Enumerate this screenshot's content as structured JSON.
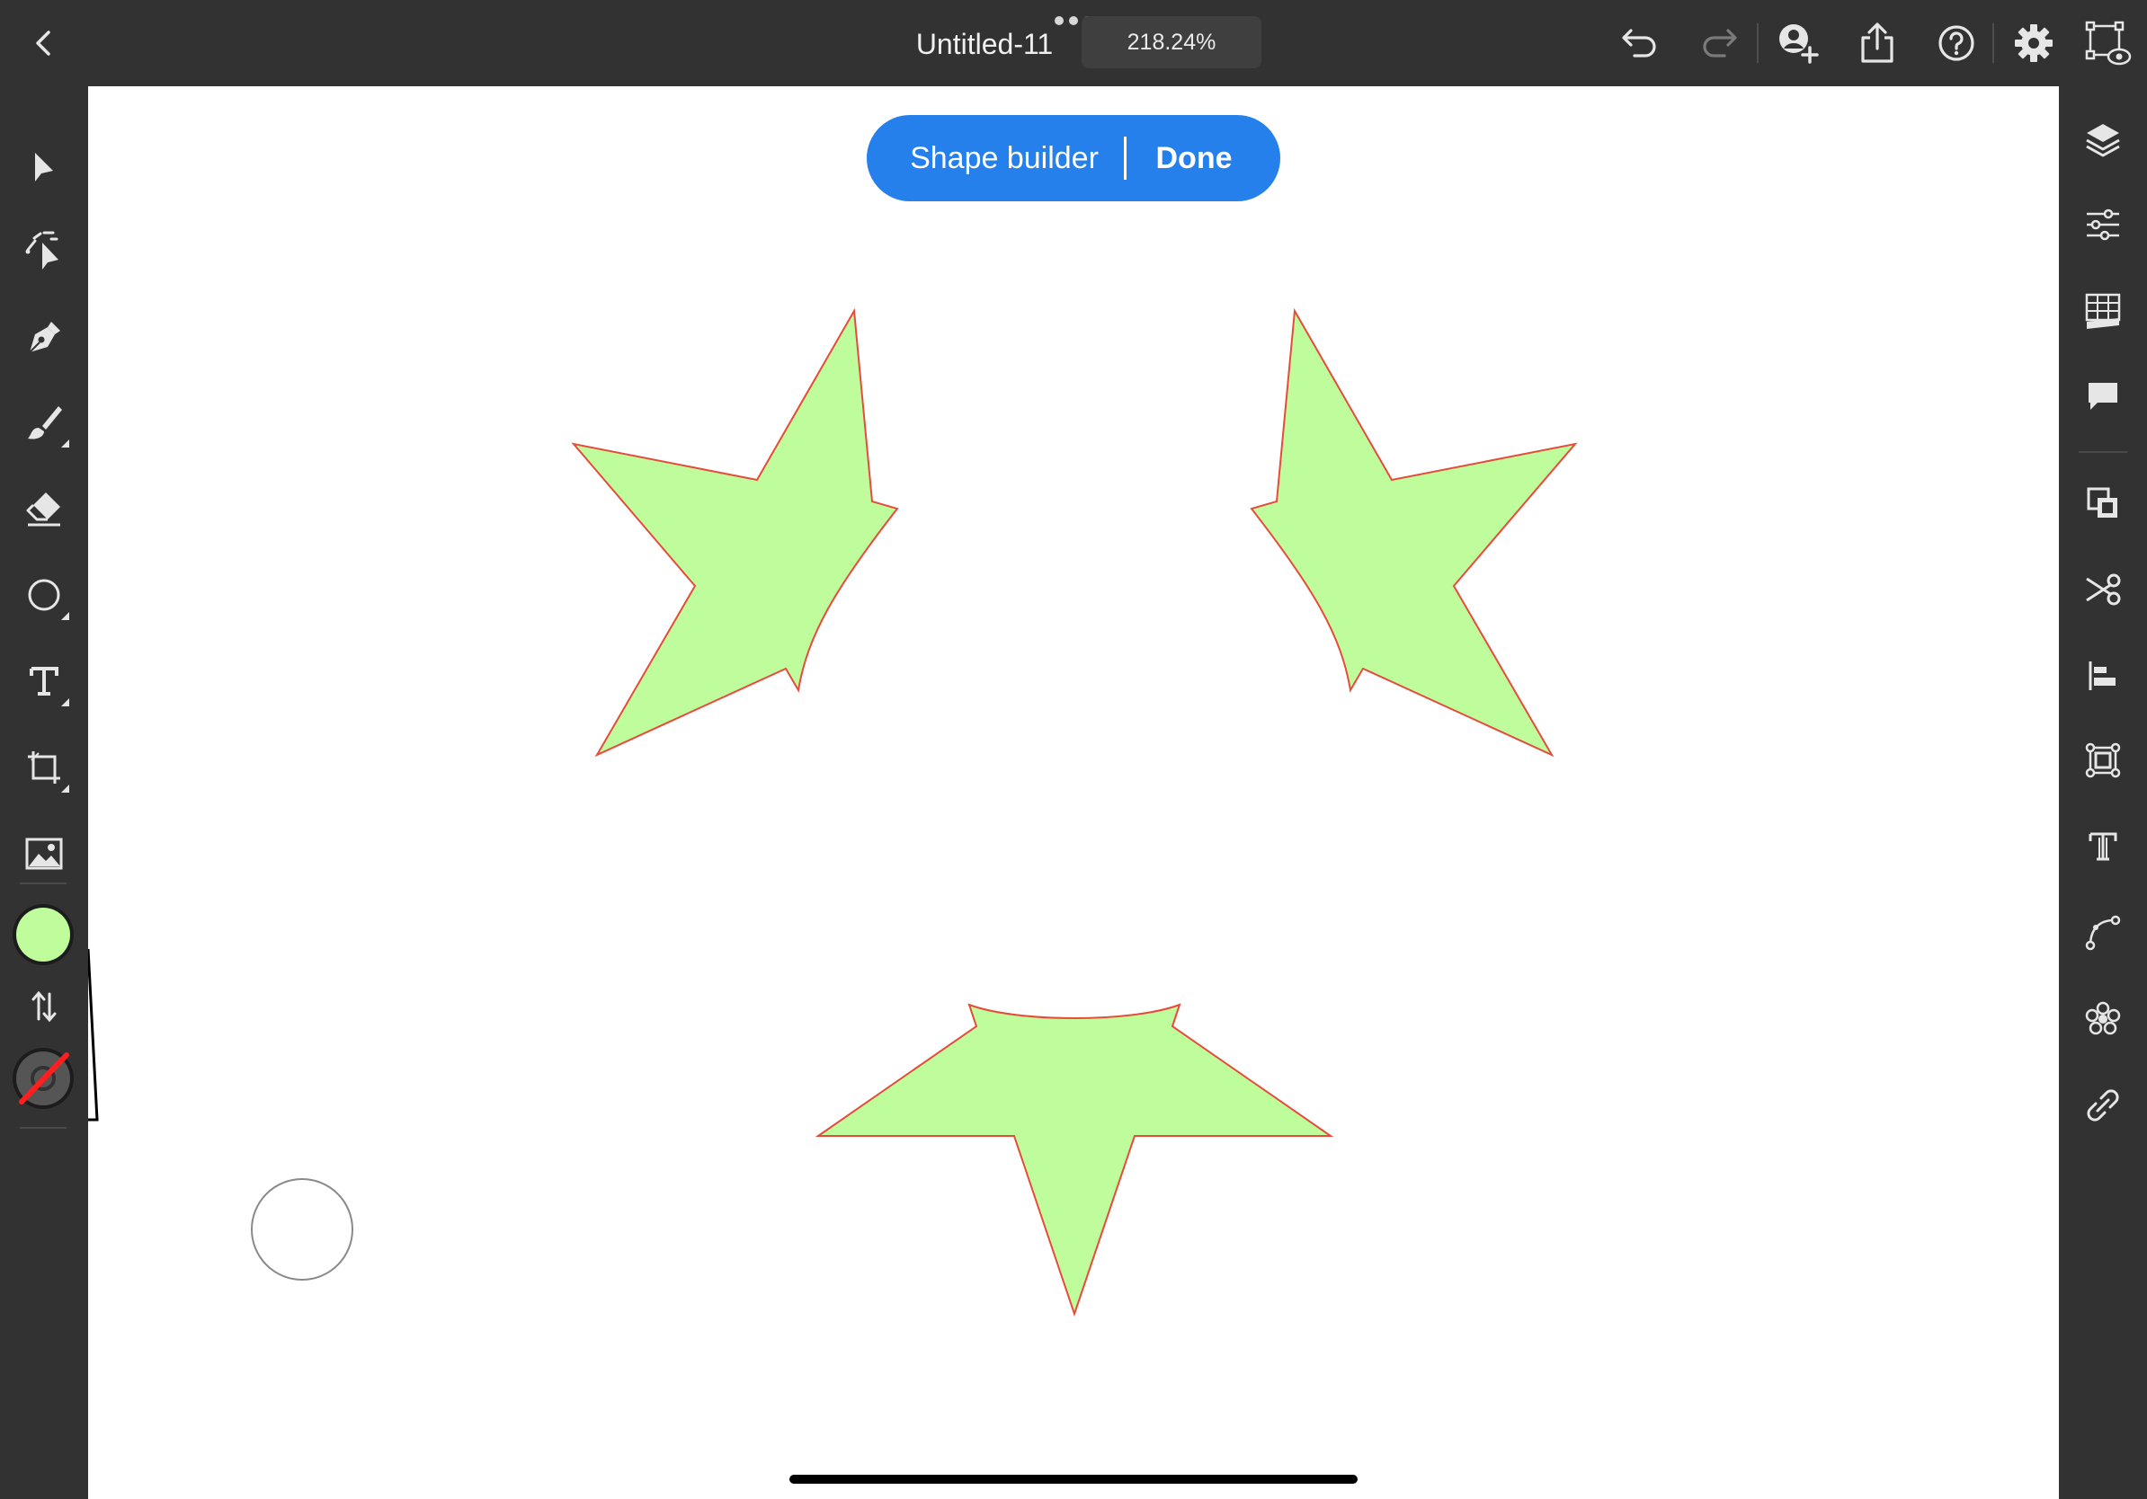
{
  "document": {
    "title": "Untitled-11",
    "zoom": "218.24%"
  },
  "shape_builder": {
    "label": "Shape builder",
    "done_label": "Done"
  },
  "colors": {
    "fill": "#bffc9b",
    "stroke_outline": "#e64b3c",
    "accent": "#2680eb",
    "ui_background": "#323232"
  },
  "top_bar_icons": [
    "back-icon",
    "more-icon",
    "undo-icon",
    "redo-icon",
    "invite-icon",
    "share-icon",
    "help-icon",
    "settings-icon",
    "preview-icon"
  ],
  "left_tools": [
    "selection-icon",
    "direct-selection-icon",
    "pen-icon",
    "brush-icon",
    "eraser-icon",
    "ellipse-icon",
    "type-icon",
    "crop-icon",
    "image-icon"
  ],
  "right_panel_icons": [
    "layers-icon",
    "properties-icon",
    "libraries-icon",
    "comments-icon",
    "arrange-icon",
    "scissors-icon",
    "align-icon",
    "transform-icon",
    "type-panel-icon",
    "path-icon",
    "repeat-icon",
    "link-icon"
  ],
  "fill_stroke": {
    "fill_color": "#bffc9b",
    "stroke": "none"
  }
}
